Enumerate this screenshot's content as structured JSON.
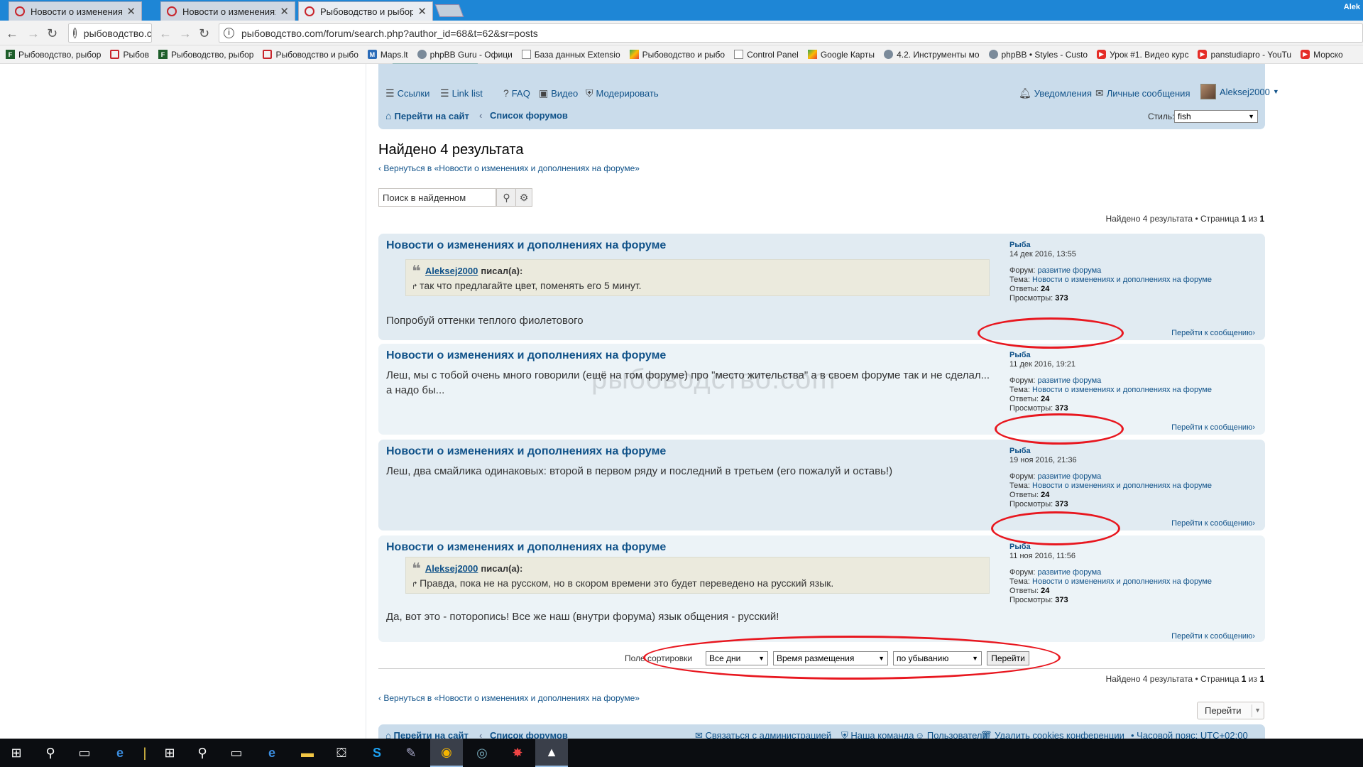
{
  "browser": {
    "tabs": [
      {
        "title": "Новости о изменениях",
        "active": false
      },
      {
        "title": "Новости о изменениях",
        "active": false
      },
      {
        "title": "Рыбоводство и рыбора",
        "active": true
      }
    ],
    "profile_name": "Alek",
    "left_address": "рыбоводство.c",
    "address": "рыбоводство.com/forum/search.php?author_id=68&t=62&sr=posts"
  },
  "bookmarks": [
    {
      "label": "Рыбоводство, рыбор",
      "icon": "green"
    },
    {
      "label": "Рыбов",
      "icon": "red"
    },
    {
      "label": "Рыбоводство, рыбор",
      "icon": "green"
    },
    {
      "label": "Рыбоводство и рыбо",
      "icon": "red"
    },
    {
      "label": "Maps.lt",
      "icon": "blue"
    },
    {
      "label": "phpBB Guru - Офици",
      "icon": "gray"
    },
    {
      "label": "База данных Extensio",
      "icon": "doc"
    },
    {
      "label": "Рыбоводство и рыбо",
      "icon": "map"
    },
    {
      "label": "Control Panel",
      "icon": "doc"
    },
    {
      "label": "Google Карты",
      "icon": "map"
    },
    {
      "label": "4.2. Инструменты мо",
      "icon": "gray"
    },
    {
      "label": "phpBB • Styles - Custo",
      "icon": "gray"
    },
    {
      "label": "Урок #1. Видео курс",
      "icon": "yt"
    },
    {
      "label": "panstudiapro - YouTu",
      "icon": "yt"
    },
    {
      "label": "Морско",
      "icon": "yt"
    }
  ],
  "forum_nav": {
    "links": "Ссылки",
    "link_list": "Link list",
    "faq": "FAQ",
    "video": "Видео",
    "moderate": "Модерировать",
    "notifications": "Уведомления",
    "pm": "Личные сообщения",
    "username": "Aleksej2000",
    "goto_site": "Перейти на сайт",
    "forum_list": "Список форумов",
    "style_label": "Стиль:",
    "style_value": "fish"
  },
  "results": {
    "title": "Найдено 4 результата",
    "back": "Вернуться в «Новости о изменениях и дополнениях на форуме»",
    "search_placeholder": "Поиск в найденном",
    "pagination_prefix": "Найдено 4 результата • Страница",
    "page": "1",
    "of": "из",
    "total_pages": "1"
  },
  "posts": [
    {
      "title": "Новости о изменениях и дополнениях на форуме",
      "quote_user": "Aleksej2000",
      "quote_wrote": "писал(а):",
      "quote_text": "так что предлагайте цвет, поменять его 5 минут.",
      "body": "Попробуй оттенки теплого фиолетового",
      "author": "Рыба",
      "date": "14 дек 2016, 13:55",
      "forum_label": "Форум:",
      "forum": "развитие форума",
      "topic_label": "Тема:",
      "topic": "Новости о изменениях и дополнениях на форуме",
      "replies_label": "Ответы:",
      "replies": "24",
      "views_label": "Просмотры:",
      "views": "373",
      "goto": "Перейти к сообщению"
    },
    {
      "title": "Новости о изменениях и дополнениях на форуме",
      "body": "Леш, мы с тобой очень много говорили (ещё на том форуме) про \"место жительства\" а в своем форуме так и не сделал... а надо бы...",
      "author": "Рыба",
      "date": "11 дек 2016, 19:21",
      "forum_label": "Форум:",
      "forum": "развитие форума",
      "topic_label": "Тема:",
      "topic": "Новости о изменениях и дополнениях на форуме",
      "replies_label": "Ответы:",
      "replies": "24",
      "views_label": "Просмотры:",
      "views": "373",
      "goto": "Перейти к сообщению"
    },
    {
      "title": "Новости о изменениях и дополнениях на форуме",
      "body": "Леш, два смайлика одинаковых: второй в первом ряду и последний в третьем (его пожалуй и оставь!)",
      "author": "Рыба",
      "date": "19 ноя 2016, 21:36",
      "forum_label": "Форум:",
      "forum": "развитие форума",
      "topic_label": "Тема:",
      "topic": "Новости о изменениях и дополнениях на форуме",
      "replies_label": "Ответы:",
      "replies": "24",
      "views_label": "Просмотры:",
      "views": "373",
      "goto": "Перейти к сообщению"
    },
    {
      "title": "Новости о изменениях и дополнениях на форуме",
      "quote_user": "Aleksej2000",
      "quote_wrote": "писал(а):",
      "quote_text": "Правда, пока не на русском, но в скором времени это будет переведено на русский язык.",
      "body": "Да, вот это - поторопись! Все же наш (внутри форума) язык общения - русский!",
      "author": "Рыба",
      "date": "11 ноя 2016, 11:56",
      "forum_label": "Форум:",
      "forum": "развитие форума",
      "topic_label": "Тема:",
      "topic": "Новости о изменениях и дополнениях на форуме",
      "replies_label": "Ответы:",
      "replies": "24",
      "views_label": "Просмотры:",
      "views": "373",
      "goto": "Перейти к сообщению"
    }
  ],
  "watermark": "рыбоводство.com",
  "sort": {
    "label": "Поле сортировки",
    "days": "Все дни",
    "field": "Время размещения",
    "order": "по убыванию",
    "go": "Перейти"
  },
  "jump": {
    "label": "Перейти"
  },
  "footer": {
    "goto_site": "Перейти на сайт",
    "forum_list": "Список форумов",
    "contact": "Связаться с администрацией",
    "team": "Наша команда",
    "users": "Пользователи",
    "cookies": "Удалить cookies конференции",
    "tz": "Часовой пояс: UTC+02:00"
  },
  "colors": {
    "annotation": "#e8171f",
    "link": "#105289",
    "navbar": "#cadceb"
  }
}
